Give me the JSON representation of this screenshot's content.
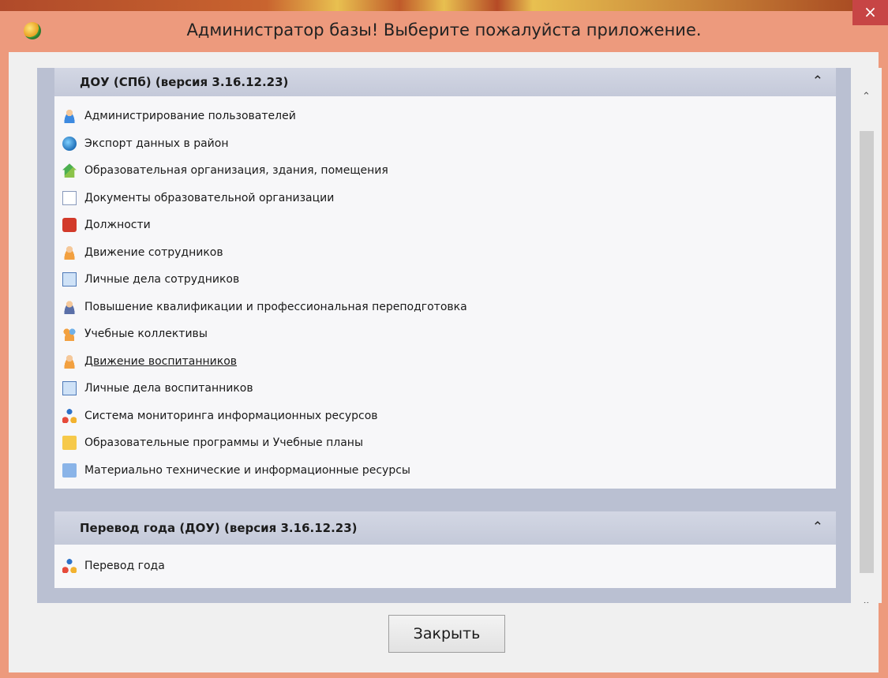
{
  "window": {
    "title": "Администратор базы! Выберите пожалуйста приложение.",
    "close_glyph": "×"
  },
  "groups": [
    {
      "title": "ДОУ (СПб) (версия 3.16.12.23)",
      "collapse_glyph": "⌃",
      "items": [
        {
          "label": "Администрирование пользователей",
          "icon": "user-icon"
        },
        {
          "label": "Экспорт данных в район",
          "icon": "globe-export-icon"
        },
        {
          "label": "Образовательная организация, здания, помещения",
          "icon": "building-icon"
        },
        {
          "label": "Документы образовательной организации",
          "icon": "document-icon"
        },
        {
          "label": "Должности",
          "icon": "briefcase-icon"
        },
        {
          "label": "Движение сотрудников",
          "icon": "employee-icon"
        },
        {
          "label": "Личные дела сотрудников",
          "icon": "id-card-icon"
        },
        {
          "label": "Повышение квалификации и профессиональная переподготовка",
          "icon": "training-icon"
        },
        {
          "label": "Учебные коллективы",
          "icon": "group-icon"
        },
        {
          "label": "Движение воспитанников",
          "icon": "pupil-icon"
        },
        {
          "label": "Личные дела воспитанников",
          "icon": "id-card-icon"
        },
        {
          "label": "Система мониторинга информационных ресурсов",
          "icon": "network-icon"
        },
        {
          "label": "Образовательные программы и Учебные планы",
          "icon": "folder-icon"
        },
        {
          "label": "Материально технические и информационные ресурсы",
          "icon": "computer-icon"
        }
      ]
    },
    {
      "title": "Перевод года (ДОУ) (версия 3.16.12.23)",
      "collapse_glyph": "⌃",
      "items": [
        {
          "label": "Перевод года",
          "icon": "network-icon"
        }
      ]
    }
  ],
  "scrollbar": {
    "up_glyph": "⌃",
    "down_glyph": "⌄"
  },
  "footer": {
    "close_label": "Закрыть"
  }
}
